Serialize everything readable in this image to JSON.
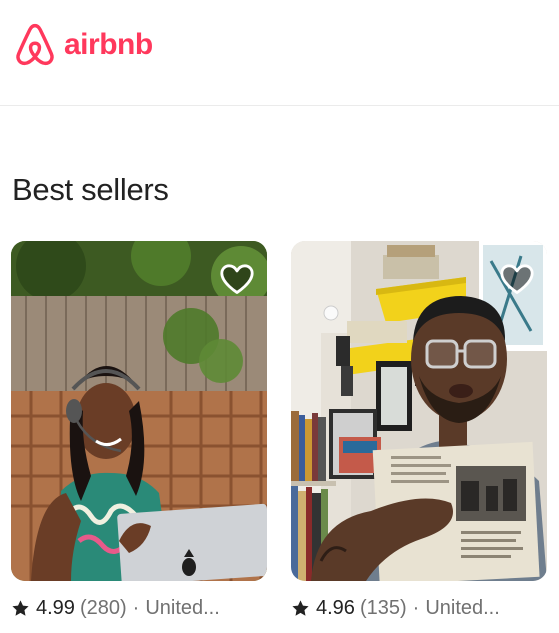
{
  "header": {
    "logo_text": "airbnb",
    "brand_color": "#ff385c"
  },
  "section": {
    "title": "Best sellers"
  },
  "cards": [
    {
      "rating": "4.99",
      "reviews": "(280)",
      "separator": "·",
      "location": "United...",
      "icons": [
        "heart-icon",
        "star-icon"
      ]
    },
    {
      "rating": "4.96",
      "reviews": "(135)",
      "separator": "·",
      "location": "United...",
      "icons": [
        "heart-icon",
        "star-icon"
      ]
    }
  ]
}
